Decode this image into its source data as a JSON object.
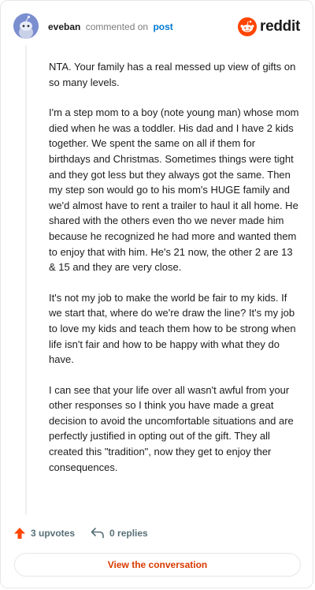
{
  "header": {
    "username": "eveban",
    "action": "commented on",
    "target": "post",
    "brand": "reddit"
  },
  "comment": {
    "paragraphs": [
      "NTA. Your family has a real messed up view of gifts on so many levels.",
      "I'm a step mom to a boy (note young man) whose mom died when he was a toddler. His dad and I have 2 kids together. We spent the same on all if them for birthdays and Christmas. Sometimes things were tight and they got less but they always got the same. Then my step son would go to his mom's HUGE family and we'd almost have to rent a trailer to haul it all home. He shared with the others even tho we never made him because he recognized he had more and wanted them to enjoy that with him. He's 21 now, the other 2 are 13 & 15 and they are very close.",
      "It's not my job to make the world be fair to my kids. If we start that, where do we're draw the line? It's my job to love my kids and teach them how to be strong when life isn't fair and how to be happy with what they do have.",
      "I can see that your life over all wasn't awful from your other responses so I think you have made a great decision to avoid the uncomfortable situations and are perfectly justified in opting out of the gift. They all created this \"tradition\", now they get to enjoy ther consequences."
    ]
  },
  "footer": {
    "upvotes": "3 upvotes",
    "replies": "0 replies",
    "cta": "View the conversation"
  },
  "colors": {
    "upvote": "#ff4500",
    "link": "#0079d3",
    "cta": "#d93a00"
  },
  "icons": {
    "avatar": "snoo-avatar-icon",
    "logo": "reddit-logo-icon",
    "upvote": "upvote-arrow-icon",
    "reply": "reply-arrow-icon"
  }
}
